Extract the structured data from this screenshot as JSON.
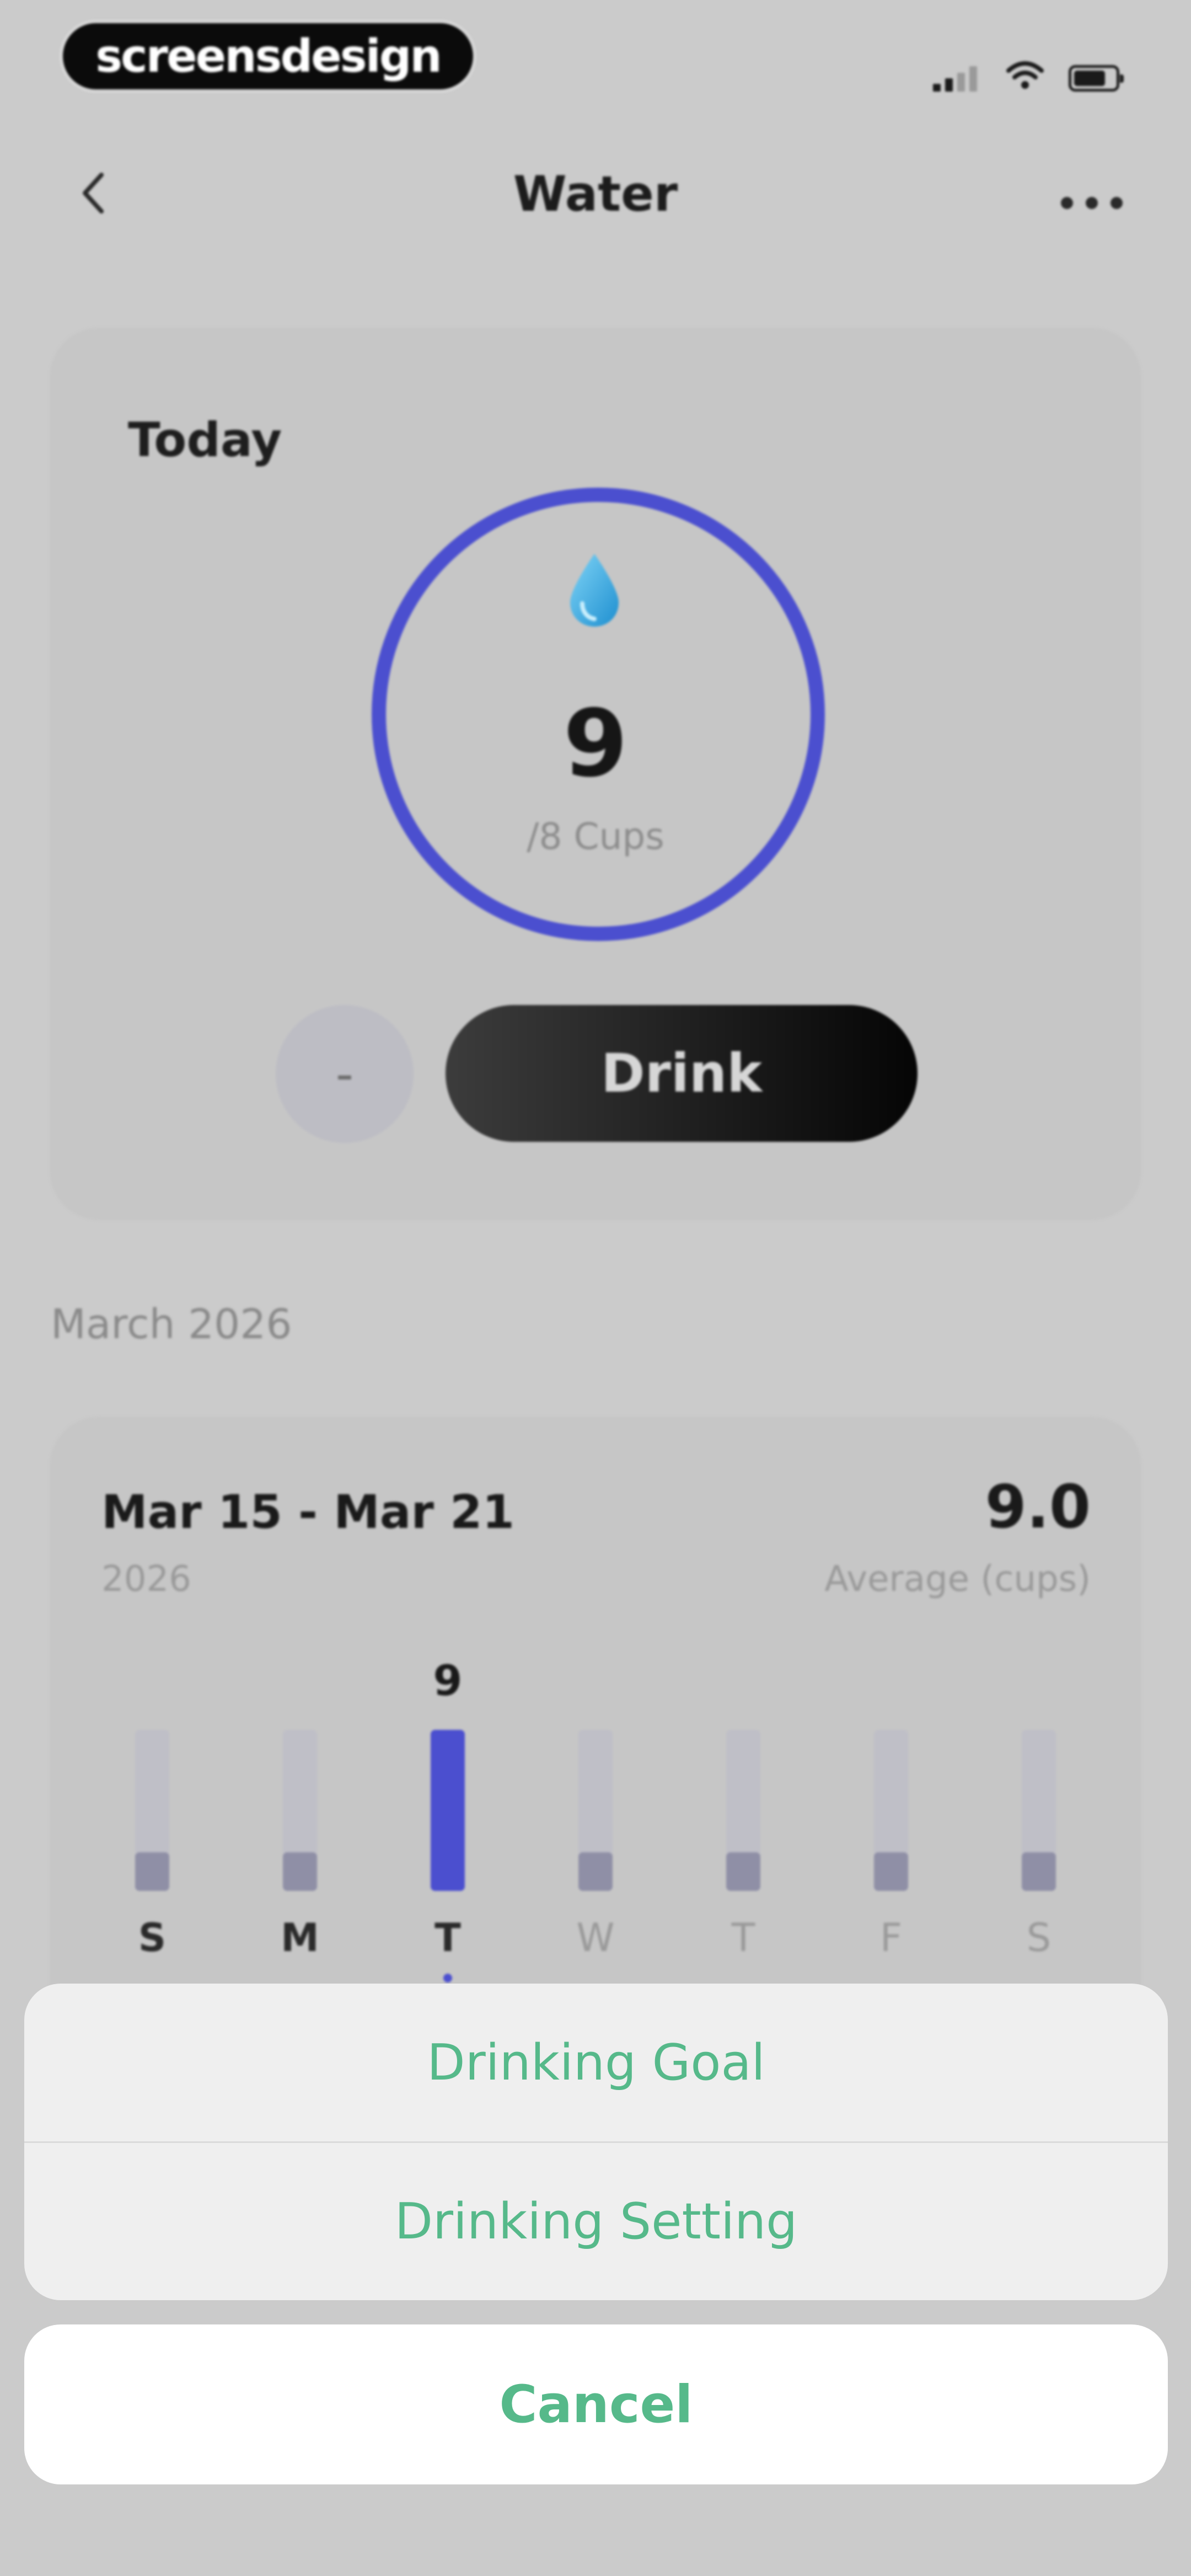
{
  "status_bar": {
    "brand": "screensdesign",
    "icons": [
      "signal-icon",
      "wifi-icon",
      "battery-icon"
    ]
  },
  "nav": {
    "back_icon": "chevron-left-icon",
    "title": "Water",
    "more_icon": "more-horizontal-icon"
  },
  "today": {
    "label": "Today",
    "count": "9",
    "goal_text": "/8 Cups",
    "progress": 1.0,
    "minus_label": "-",
    "drink_label": "Drink",
    "accent_color": "#4b4fcf"
  },
  "history": {
    "month_label": "March 2026",
    "range": "Mar 15 - Mar 21",
    "year": "2026",
    "average_value": "9.0",
    "average_label": "Average (cups)"
  },
  "chart_data": {
    "type": "bar",
    "categories": [
      "S",
      "M",
      "T",
      "W",
      "T",
      "F",
      "S"
    ],
    "values": [
      0,
      0,
      9,
      0,
      0,
      0,
      0
    ],
    "value_labels": [
      "",
      "",
      "9",
      "",
      "",
      "",
      ""
    ],
    "selected_index": 2,
    "ylim": [
      0,
      9
    ]
  },
  "action_sheet": {
    "item_1": "Drinking Goal",
    "item_2": "Drinking Setting",
    "cancel": "Cancel",
    "text_color": "#56b98a"
  }
}
